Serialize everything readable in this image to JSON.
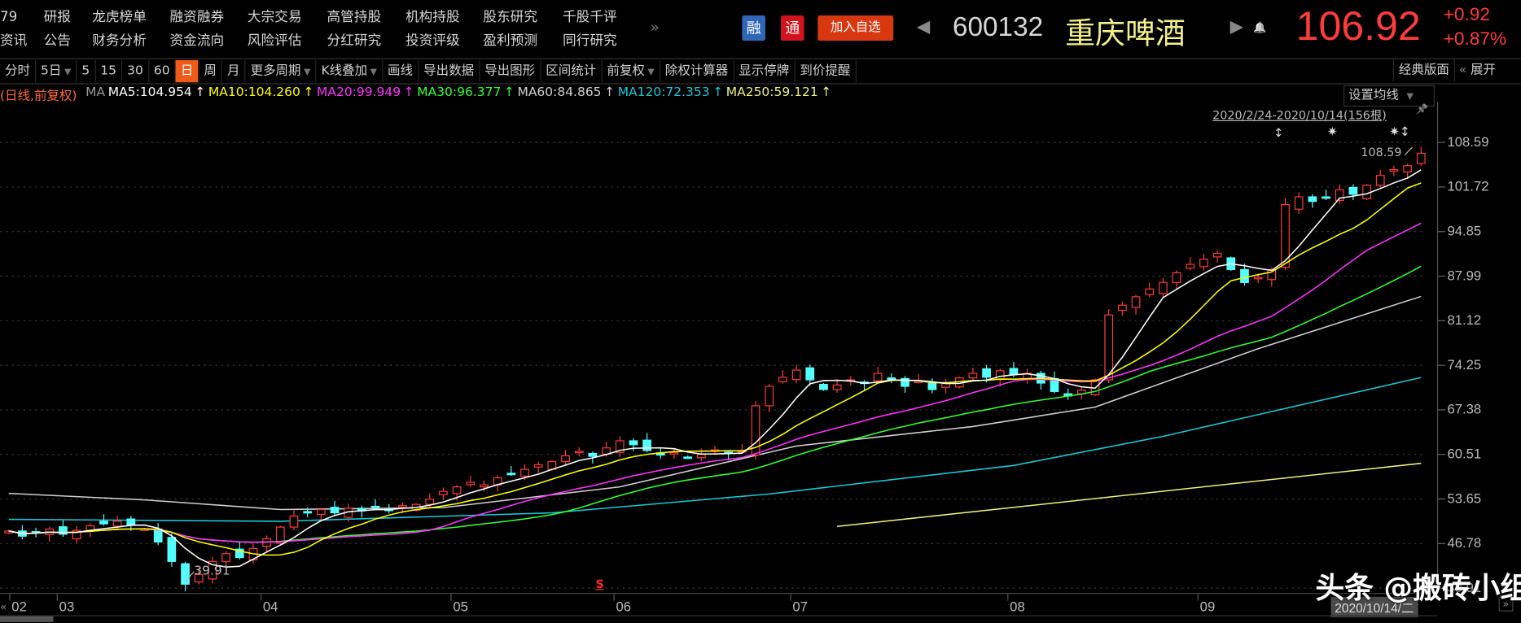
{
  "menu": {
    "columns": [
      [
        "79",
        "资讯"
      ],
      [
        "研报",
        "公告"
      ],
      [
        "龙虎榜单",
        "财务分析"
      ],
      [
        "融资融券",
        "资金流向"
      ],
      [
        "大宗交易",
        "风险评估"
      ],
      [
        "高管持股",
        "分红研究"
      ],
      [
        "机构持股",
        "投资评级"
      ],
      [
        "股东研究",
        "盈利预测"
      ],
      [
        "千股千评",
        "同行研究"
      ]
    ],
    "more": "»"
  },
  "header": {
    "rong": "融",
    "tong": "通",
    "add_watchlist": "加入自选",
    "prev": "◀",
    "code": "600132",
    "name": "重庆啤酒",
    "next": "▶",
    "bell": "🔔",
    "price": "106.92",
    "change": "+0.92",
    "change_pct": "+0.87%"
  },
  "toolbar": {
    "items": [
      {
        "label": "分时"
      },
      {
        "label": "5日",
        "dd": true
      },
      {
        "label": "5"
      },
      {
        "label": "15"
      },
      {
        "label": "30"
      },
      {
        "label": "60"
      },
      {
        "label": "日",
        "active": true
      },
      {
        "label": "周"
      },
      {
        "label": "月"
      },
      {
        "label": "更多周期",
        "dd": true
      },
      {
        "label": "K线叠加",
        "dd": true
      },
      {
        "label": "画线"
      },
      {
        "label": "导出数据"
      },
      {
        "label": "导出图形"
      },
      {
        "label": "区间统计"
      },
      {
        "label": "前复权",
        "dd": true
      },
      {
        "label": "除权计算器"
      },
      {
        "label": "显示停牌"
      },
      {
        "label": "到价提醒"
      }
    ],
    "classic_layout": "经典版面",
    "expand_arrow": "«",
    "expand": "展开"
  },
  "legend": {
    "mode": "(日线,前复权)",
    "ma": "MA",
    "items": [
      {
        "text": "MA5:104.954",
        "color": "#ffffff"
      },
      {
        "text": "MA10:104.260",
        "color": "#ffff00"
      },
      {
        "text": "MA20:99.949",
        "color": "#ff33ff"
      },
      {
        "text": "MA30:96.377",
        "color": "#33ff33"
      },
      {
        "text": "MA60:84.865",
        "color": "#d0d0d0"
      },
      {
        "text": "MA120:72.353",
        "color": "#19c8d8"
      },
      {
        "text": "MA250:59.121",
        "color": "#f0f080"
      }
    ],
    "arrow": "↑"
  },
  "chart_controls": {
    "set_ma": "设置均线",
    "range": "2020/2/24-2020/10/14(156根)",
    "pin": "📌"
  },
  "chart_data": {
    "type": "candlestick",
    "y_ticks": [
      "108.59",
      "101.72",
      "94.85",
      "87.99",
      "81.12",
      "74.25",
      "67.38",
      "60.51",
      "53.65",
      "46.78",
      "39.91"
    ],
    "ylim": [
      39.91,
      108.59
    ],
    "x_ticks": [
      {
        "label": "02",
        "i": 0
      },
      {
        "label": "03",
        "i": 4
      },
      {
        "label": "04",
        "i": 19
      },
      {
        "label": "05",
        "i": 33
      },
      {
        "label": "06",
        "i": 45
      },
      {
        "label": "07",
        "i": 58
      },
      {
        "label": "08",
        "i": 74
      },
      {
        "label": "09",
        "i": 88
      }
    ],
    "closes": [
      48.7,
      47.9,
      48.5,
      49.0,
      48.2,
      48.8,
      49.5,
      49.8,
      50.2,
      49.6,
      49.0,
      47.0,
      44.0,
      40.5,
      42.0,
      44.0,
      45.2,
      44.6,
      46.0,
      47.5,
      49.3,
      51.0,
      51.6,
      52.0,
      51.5,
      52.2,
      51.8,
      52.4,
      52.0,
      52.6,
      52.8,
      53.6,
      54.8,
      55.5,
      56.2,
      55.8,
      56.9,
      57.5,
      58.2,
      58.9,
      59.4,
      60.3,
      61.0,
      60.2,
      61.5,
      62.6,
      62.0,
      61.1,
      60.4,
      60.8,
      60.0,
      60.5,
      61.2,
      60.7,
      61.1,
      68.0,
      71.0,
      72.4,
      73.5,
      72.0,
      70.5,
      71.2,
      72.0,
      71.5,
      73.0,
      72.2,
      71.0,
      71.8,
      70.5,
      71.6,
      72.3,
      73.0,
      72.4,
      73.4,
      72.8,
      73.0,
      71.5,
      70.2,
      69.5,
      70.4,
      72.0,
      82.0,
      83.5,
      84.8,
      86.0,
      87.0,
      88.5,
      89.8,
      90.6,
      91.5,
      89.0,
      87.0,
      87.8,
      89.0,
      99.0,
      100.2,
      99.5,
      100.0,
      101.3,
      100.6,
      102.0,
      103.5,
      104.4,
      105.0,
      106.92
    ],
    "ma_long": {
      "MA60": [
        [
          0,
          54.5
        ],
        [
          10,
          53.5
        ],
        [
          20,
          52.0
        ],
        [
          32,
          52.3
        ],
        [
          45,
          55.5
        ],
        [
          58,
          61.8
        ],
        [
          71,
          64.8
        ],
        [
          80,
          67.8
        ],
        [
          92,
          76.8
        ],
        [
          104,
          84.865
        ]
      ],
      "MA120": [
        [
          0,
          50.5
        ],
        [
          20,
          50.2
        ],
        [
          40,
          51.5
        ],
        [
          56,
          54.4
        ],
        [
          74,
          58.8
        ],
        [
          85,
          63.3
        ],
        [
          104,
          72.353
        ]
      ],
      "MA250": [
        [
          61,
          49.4
        ],
        [
          104,
          59.121
        ]
      ]
    },
    "annotations": {
      "high": "108.59",
      "low": "39.91"
    },
    "event_marks": [
      "↕",
      "✷",
      "✷↕"
    ],
    "signal_mark": "S"
  },
  "footer": {
    "scroll_left": "«",
    "scroll_right": "»",
    "cursor_date": "2020/10/14/二",
    "watermark": "头条 @搬砖小组招财喵"
  },
  "colors": {
    "up": "#ff3b3b",
    "down": "#54ffff",
    "accent": "#ef5a18",
    "rong": "#2f66b8",
    "tong": "#d0141e"
  }
}
